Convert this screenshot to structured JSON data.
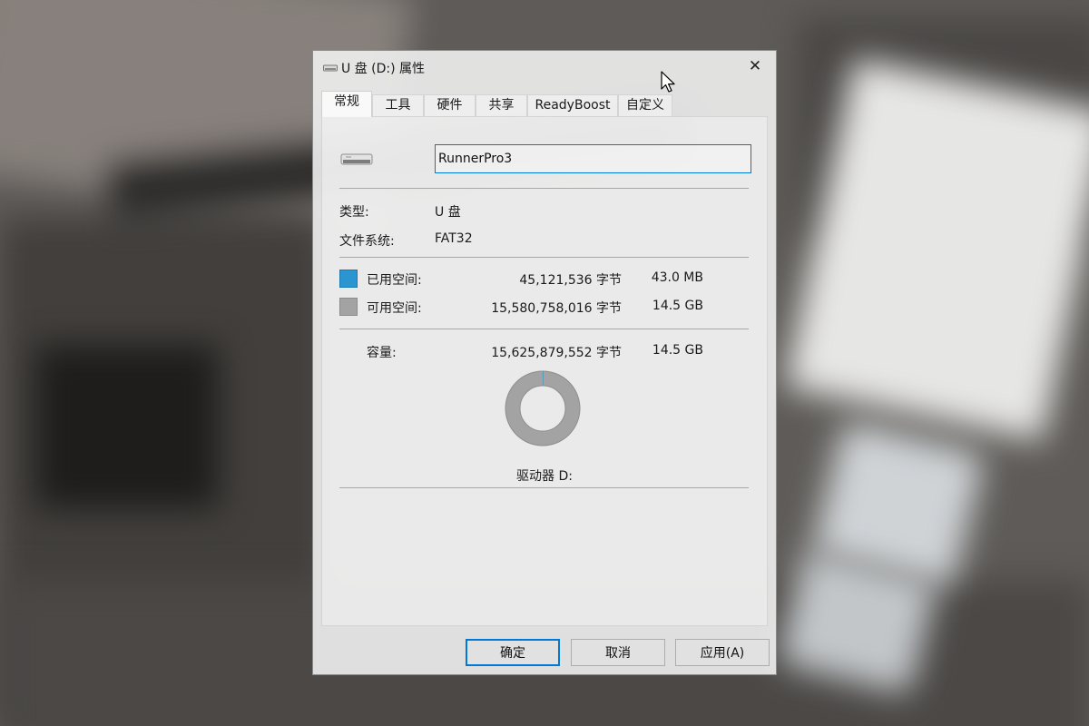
{
  "window": {
    "title": "U 盘 (D:) 属性",
    "close_glyph": "✕"
  },
  "tabs": [
    {
      "label": "常规",
      "active": true
    },
    {
      "label": "工具"
    },
    {
      "label": "硬件"
    },
    {
      "label": "共享"
    },
    {
      "label": "ReadyBoost"
    },
    {
      "label": "自定义"
    }
  ],
  "general": {
    "volume_name": "RunnerPro3",
    "type_label": "类型:",
    "type_value": "U 盘",
    "fs_label": "文件系统:",
    "fs_value": "FAT32",
    "used": {
      "label": "已用空间:",
      "bytes": "45,121,536 字节",
      "size": "43.0 MB"
    },
    "free": {
      "label": "可用空间:",
      "bytes": "15,580,758,016 字节",
      "size": "14.5 GB"
    },
    "capacity": {
      "label": "容量:",
      "bytes": "15,625,879,552 字节",
      "size": "14.5 GB"
    },
    "drive_label": "驱动器 D:",
    "used_fraction": 0.0029
  },
  "buttons": {
    "ok": "确定",
    "cancel": "取消",
    "apply": "应用(A)"
  },
  "colors": {
    "used": "#2a95d0",
    "free": "#a3a3a3",
    "accent": "#0078d7"
  },
  "icons": {
    "title": "usb-drive-icon",
    "drive": "usb-drive-icon",
    "cursor": "mouse-cursor-icon"
  }
}
